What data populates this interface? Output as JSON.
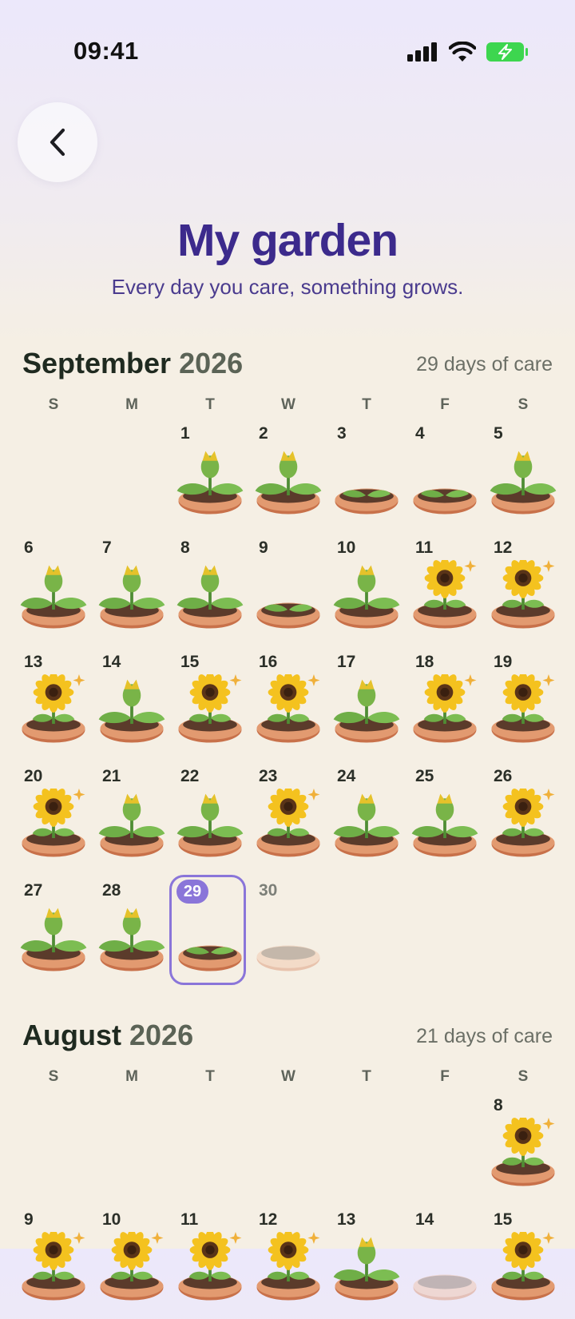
{
  "status_bar": {
    "time": "09:41"
  },
  "header": {
    "back_icon": "chevron-left-icon",
    "title": "My garden",
    "subtitle": "Every day you care, something grows."
  },
  "colors": {
    "title": "#3c2a8c",
    "accent_today": "#8a75d9",
    "battery": "#3dd64f",
    "background": "#f5efe4"
  },
  "weekdays": [
    "S",
    "M",
    "T",
    "W",
    "T",
    "F",
    "S"
  ],
  "months": [
    {
      "name": "September",
      "year": "2026",
      "care_text": "29 days of care",
      "first_weekday": 2,
      "days": [
        {
          "day": "1",
          "plant": "bud"
        },
        {
          "day": "2",
          "plant": "bud"
        },
        {
          "day": "3",
          "plant": "sprout"
        },
        {
          "day": "4",
          "plant": "sprout"
        },
        {
          "day": "5",
          "plant": "bud"
        },
        {
          "day": "6",
          "plant": "bud"
        },
        {
          "day": "7",
          "plant": "bud"
        },
        {
          "day": "8",
          "plant": "bud"
        },
        {
          "day": "9",
          "plant": "sprout"
        },
        {
          "day": "10",
          "plant": "bud"
        },
        {
          "day": "11",
          "plant": "sunflower"
        },
        {
          "day": "12",
          "plant": "sunflower"
        },
        {
          "day": "13",
          "plant": "sunflower"
        },
        {
          "day": "14",
          "plant": "bud"
        },
        {
          "day": "15",
          "plant": "sunflower"
        },
        {
          "day": "16",
          "plant": "sunflower"
        },
        {
          "day": "17",
          "plant": "bud"
        },
        {
          "day": "18",
          "plant": "sunflower"
        },
        {
          "day": "19",
          "plant": "sunflower"
        },
        {
          "day": "20",
          "plant": "sunflower"
        },
        {
          "day": "21",
          "plant": "bud"
        },
        {
          "day": "22",
          "plant": "bud"
        },
        {
          "day": "23",
          "plant": "sunflower"
        },
        {
          "day": "24",
          "plant": "bud"
        },
        {
          "day": "25",
          "plant": "bud"
        },
        {
          "day": "26",
          "plant": "sunflower"
        },
        {
          "day": "27",
          "plant": "bud"
        },
        {
          "day": "28",
          "plant": "bud"
        },
        {
          "day": "29",
          "plant": "sprout",
          "today": true
        },
        {
          "day": "30",
          "plant": "empty",
          "future": true
        }
      ]
    },
    {
      "name": "August",
      "year": "2026",
      "care_text": "21 days of care",
      "first_weekday": 6,
      "days": [
        {
          "day": "8",
          "plant": "sunflower"
        },
        {
          "day": "9",
          "plant": "sunflower"
        },
        {
          "day": "10",
          "plant": "sunflower"
        },
        {
          "day": "11",
          "plant": "sunflower"
        },
        {
          "day": "12",
          "plant": "sunflower"
        },
        {
          "day": "13",
          "plant": "bud"
        },
        {
          "day": "14",
          "plant": "empty"
        },
        {
          "day": "15",
          "plant": "sunflower"
        }
      ]
    }
  ]
}
